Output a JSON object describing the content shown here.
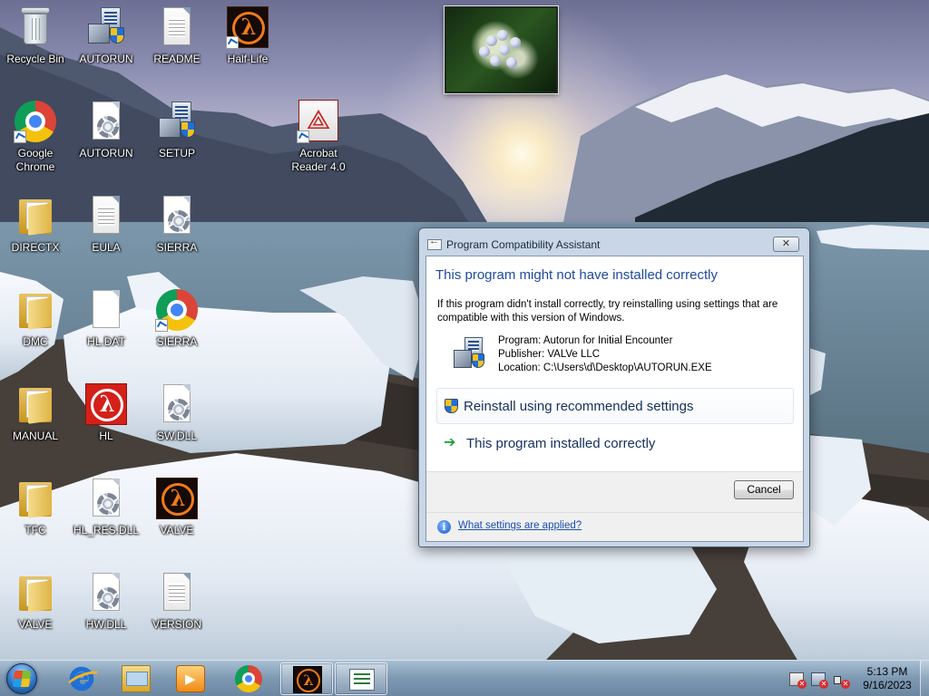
{
  "desktop": {
    "icons": [
      {
        "label": "Recycle Bin",
        "icon": "recycle-bin-icon"
      },
      {
        "label": "AUTORUN",
        "icon": "setup-icon"
      },
      {
        "label": "README",
        "icon": "text-document-icon"
      },
      {
        "label": "Half-Life",
        "icon": "half-life-icon"
      },
      {
        "label": "Google Chrome",
        "icon": "chrome-icon"
      },
      {
        "label": "AUTORUN",
        "icon": "config-file-icon"
      },
      {
        "label": "SETUP",
        "icon": "setup-icon"
      },
      {
        "label": "Acrobat Reader 4.0",
        "icon": "acrobat-icon"
      },
      {
        "label": "DIRECTX",
        "icon": "folder-icon"
      },
      {
        "label": "EULA",
        "icon": "text-document-icon"
      },
      {
        "label": "SIERRA",
        "icon": "config-file-icon"
      },
      {
        "label": "DMC",
        "icon": "folder-icon"
      },
      {
        "label": "HL.DAT",
        "icon": "blank-file-icon"
      },
      {
        "label": "SIERRA",
        "icon": "chrome-icon"
      },
      {
        "label": "MANUAL",
        "icon": "folder-icon"
      },
      {
        "label": "HL",
        "icon": "half-life-red-icon"
      },
      {
        "label": "SW.DLL",
        "icon": "dll-file-icon"
      },
      {
        "label": "TFC",
        "icon": "folder-icon"
      },
      {
        "label": "HL_RES.DLL",
        "icon": "dll-file-icon"
      },
      {
        "label": "VALVE",
        "icon": "half-life-icon"
      },
      {
        "label": "VALVE",
        "icon": "folder-icon"
      },
      {
        "label": "HW.DLL",
        "icon": "dll-file-icon"
      },
      {
        "label": "VERSION",
        "icon": "text-document-icon"
      }
    ]
  },
  "dialog": {
    "title": "Program Compatibility Assistant",
    "close_label": "✕",
    "heading": "This program might not have installed correctly",
    "description": "If this program didn't install correctly, try reinstalling using settings that are compatible with this version of Windows.",
    "program_line": "Program: Autorun for Initial Encounter",
    "publisher_line": "Publisher: VALVe LLC",
    "location_line": "Location: C:\\Users\\d\\Desktop\\AUTORUN.EXE",
    "option_reinstall": "Reinstall using recommended settings",
    "option_installed": "This program installed correctly",
    "cancel_label": "Cancel",
    "help_link": "What settings are applied?"
  },
  "taskbar": {
    "pinned": [
      {
        "name": "internet-explorer",
        "icon": "internet-explorer-icon"
      },
      {
        "name": "windows-explorer",
        "icon": "folder-explorer-icon"
      },
      {
        "name": "media-player",
        "icon": "media-player-icon"
      },
      {
        "name": "google-chrome",
        "icon": "chrome-icon"
      },
      {
        "name": "half-life",
        "icon": "half-life-icon",
        "active": true
      },
      {
        "name": "compatibility-assistant",
        "icon": "list-window-icon",
        "active": true
      }
    ],
    "clock_time": "5:13 PM",
    "clock_date": "9/16/2023"
  },
  "colors": {
    "dialog_heading": "#1e4a9c",
    "link": "#1a4fb5",
    "command_text": "#15305e",
    "taskbar": "#7d98b2"
  }
}
